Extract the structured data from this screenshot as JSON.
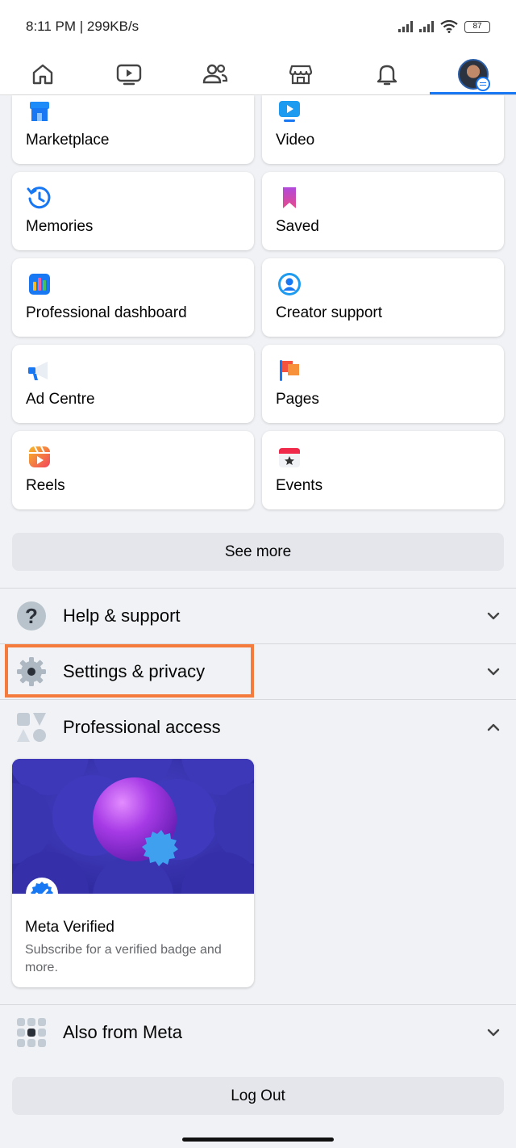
{
  "status": {
    "time_speed": "8:11 PM | 299KB/s",
    "battery": "87"
  },
  "nav": {
    "tabs": [
      "home",
      "watch",
      "friends",
      "marketplace",
      "notifications",
      "menu"
    ],
    "active": "menu"
  },
  "shortcuts": [
    {
      "label": "Marketplace",
      "icon": "marketplace-icon"
    },
    {
      "label": "Video",
      "icon": "video-icon"
    },
    {
      "label": "Memories",
      "icon": "memories-icon"
    },
    {
      "label": "Saved",
      "icon": "saved-icon"
    },
    {
      "label": "Professional dashboard",
      "icon": "dashboard-icon"
    },
    {
      "label": "Creator support",
      "icon": "creator-support-icon"
    },
    {
      "label": "Ad Centre",
      "icon": "megaphone-icon"
    },
    {
      "label": "Pages",
      "icon": "flag-icon"
    },
    {
      "label": "Reels",
      "icon": "reels-icon"
    },
    {
      "label": "Events",
      "icon": "calendar-icon"
    }
  ],
  "see_more": "See more",
  "sections": {
    "help": "Help & support",
    "settings": "Settings & privacy",
    "professional": "Professional access",
    "also_meta": "Also from Meta"
  },
  "meta_verified": {
    "title": "Meta Verified",
    "description": "Subscribe for a verified badge and more."
  },
  "logout": "Log Out",
  "colors": {
    "accent": "#1877f2",
    "highlight": "#f47b3b"
  }
}
